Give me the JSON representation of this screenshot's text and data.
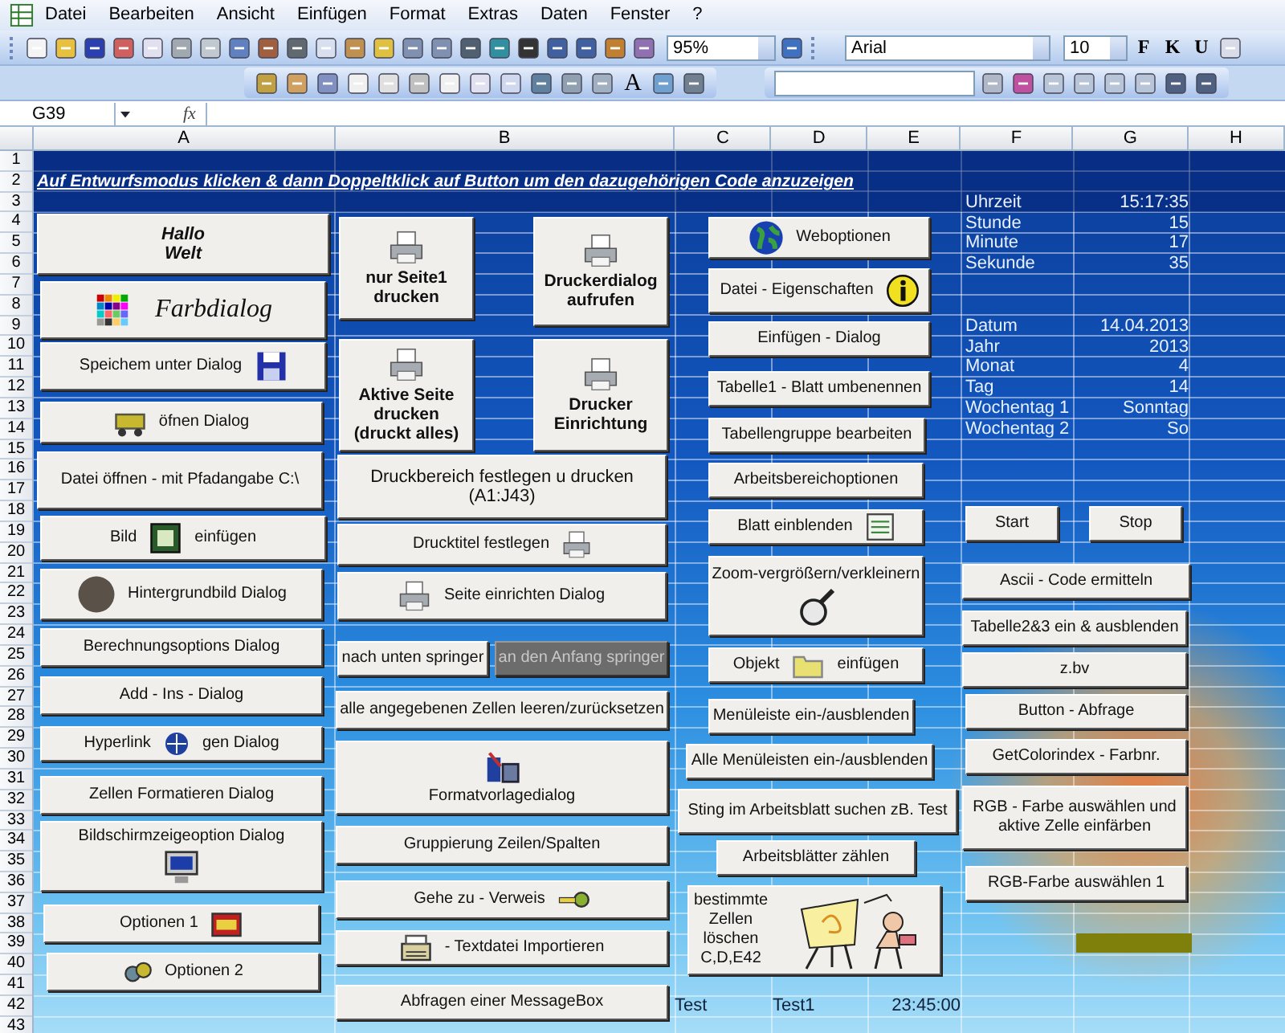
{
  "menu": [
    "Datei",
    "Bearbeiten",
    "Ansicht",
    "Einfügen",
    "Format",
    "Extras",
    "Daten",
    "Fenster",
    "?"
  ],
  "toolbar": {
    "zoom": "95%",
    "font": "Arial",
    "font_size": "10",
    "format_buttons": [
      "F",
      "K",
      "U"
    ]
  },
  "controls_toolbar": {
    "label_tool": "A"
  },
  "formula_bar": {
    "name_box": "G39",
    "formula_label": "fx"
  },
  "columns": [
    "A",
    "B",
    "C",
    "D",
    "E",
    "F",
    "G",
    "H"
  ],
  "rows": [
    "1",
    "2",
    "3",
    "4",
    "5",
    "6",
    "7",
    "8",
    "9",
    "10",
    "11",
    "12",
    "13",
    "14",
    "15",
    "16",
    "17",
    "18",
    "19",
    "20",
    "21",
    "22",
    "23",
    "24",
    "25",
    "26",
    "27",
    "28",
    "29",
    "30",
    "31",
    "32",
    "33",
    "34",
    "35",
    "36",
    "37",
    "38",
    "39",
    "40",
    "41",
    "42",
    "43"
  ],
  "sheet": {
    "title": "Auf Entwurfsmodus klicken & dann Doppeltklick auf Button um den dazugehörigen Code anzuzeigen",
    "time_info": [
      {
        "label": "Uhrzeit",
        "value": "15:17:35"
      },
      {
        "label": "Stunde",
        "value": "15"
      },
      {
        "label": "Minute",
        "value": "17"
      },
      {
        "label": "Sekunde",
        "value": "35"
      }
    ],
    "date_info": [
      {
        "label": "Datum",
        "value": "14.04.2013"
      },
      {
        "label": "Jahr",
        "value": "2013"
      },
      {
        "label": "Monat",
        "value": "4"
      },
      {
        "label": "Tag",
        "value": "14"
      },
      {
        "label": "Wochentag 1",
        "value": "Sonntag"
      },
      {
        "label": "Wochentag 2",
        "value": "So"
      }
    ],
    "row_42": [
      "Test",
      "Test1",
      "23:45:00"
    ]
  },
  "buttons": [
    {
      "lines": [
        "Hallo",
        "Welt"
      ],
      "disabled": false
    },
    {
      "lines": [
        "Farbdialog"
      ],
      "disabled": false
    },
    {
      "lines": [
        "Speichem unter Dialog"
      ],
      "disabled": false
    },
    {
      "lines": [
        "öfnen Dialog"
      ],
      "disabled": false
    },
    {
      "lines": [
        "Datei öffnen -  mit Pfadangabe C:\\"
      ],
      "disabled": false
    },
    {
      "lines": [
        "Bild",
        "einfügen"
      ],
      "disabled": false
    },
    {
      "lines": [
        "Hintergrundbild Dialog"
      ],
      "disabled": false
    },
    {
      "lines": [
        "Berechnungsoptions Dialog"
      ],
      "disabled": false
    },
    {
      "lines": [
        "Add - Ins - Dialog"
      ],
      "disabled": false
    },
    {
      "lines": [
        "Hyperlink",
        "gen Dialog"
      ],
      "disabled": false
    },
    {
      "lines": [
        "Zellen Formatieren Dialog"
      ],
      "disabled": false
    },
    {
      "lines": [
        "Bildschirmzeigeoption Dialog"
      ],
      "disabled": false
    },
    {
      "lines": [
        "Optionen 1"
      ],
      "disabled": false
    },
    {
      "lines": [
        "Optionen 2"
      ],
      "disabled": false
    },
    {
      "lines": [
        "nur Seite1",
        "drucken"
      ],
      "disabled": false
    },
    {
      "lines": [
        "Druckerdialog",
        "aufrufen"
      ],
      "disabled": false
    },
    {
      "lines": [
        "Aktive Seite",
        "drucken",
        "(druckt alles)"
      ],
      "disabled": false
    },
    {
      "lines": [
        "Drucker",
        "Einrichtung"
      ],
      "disabled": false
    },
    {
      "lines": [
        "Druckbereich festlegen u drucken",
        "(A1:J43)"
      ],
      "disabled": false
    },
    {
      "lines": [
        "Drucktitel festlegen"
      ],
      "disabled": false
    },
    {
      "lines": [
        "Seite einrichten Dialog"
      ],
      "disabled": false
    },
    {
      "lines": [
        "nach unten springer"
      ],
      "disabled": false
    },
    {
      "lines": [
        "an den Anfang springer"
      ],
      "disabled": true
    },
    {
      "lines": [
        "alle angegebenen Zellen leeren/zurücksetzen"
      ],
      "disabled": false
    },
    {
      "lines": [
        "Formatvorlagedialog"
      ],
      "disabled": false
    },
    {
      "lines": [
        "Gruppierung Zeilen/Spalten"
      ],
      "disabled": false
    },
    {
      "lines": [
        "Gehe zu   -   Verweis"
      ],
      "disabled": false
    },
    {
      "lines": [
        "- Textdatei Importieren"
      ],
      "disabled": false
    },
    {
      "lines": [
        "Abfragen einer MessageBox"
      ],
      "disabled": false
    },
    {
      "lines": [
        "Weboptionen"
      ],
      "disabled": false
    },
    {
      "lines": [
        "Datei - Eigenschaften"
      ],
      "disabled": false
    },
    {
      "lines": [
        "Einfügen - Dialog"
      ],
      "disabled": false
    },
    {
      "lines": [
        "Tabelle1 - Blatt umbenennen"
      ],
      "disabled": false
    },
    {
      "lines": [
        "Tabellengruppe bearbeiten"
      ],
      "disabled": false
    },
    {
      "lines": [
        "Arbeitsbereichoptionen"
      ],
      "disabled": false
    },
    {
      "lines": [
        "Blatt einblenden"
      ],
      "disabled": false
    },
    {
      "lines": [
        "Zoom-vergrößern/verkleinern"
      ],
      "disabled": false
    },
    {
      "lines": [
        "Objekt",
        "einfügen"
      ],
      "disabled": false
    },
    {
      "lines": [
        "Menüleiste ein-/ausblenden"
      ],
      "disabled": false
    },
    {
      "lines": [
        "Alle Menüleisten ein-/ausblenden"
      ],
      "disabled": false
    },
    {
      "lines": [
        "Sting im Arbeitsblatt suchen zB. Test"
      ],
      "disabled": false
    },
    {
      "lines": [
        "Arbeitsblätter zählen"
      ],
      "disabled": false
    },
    {
      "lines": [
        "bestimmte",
        "Zellen",
        "löschen",
        "C,D,E42"
      ],
      "disabled": false
    },
    {
      "lines": [
        "Start"
      ],
      "disabled": false
    },
    {
      "lines": [
        "Stop"
      ],
      "disabled": false
    },
    {
      "lines": [
        "Ascii - Code ermitteln"
      ],
      "disabled": false
    },
    {
      "lines": [
        "Tabelle2&3 ein & ausblenden"
      ],
      "disabled": false
    },
    {
      "lines": [
        "z.bv"
      ],
      "disabled": false
    },
    {
      "lines": [
        "Button - Abfrage"
      ],
      "disabled": false
    },
    {
      "lines": [
        "GetColorindex - Farbnr."
      ],
      "disabled": false
    },
    {
      "lines": [
        "RGB - Farbe auswählen und",
        "aktive Zelle einfärben"
      ],
      "disabled": false
    },
    {
      "lines": [
        "RGB-Farbe auswählen 1"
      ],
      "disabled": false
    }
  ]
}
